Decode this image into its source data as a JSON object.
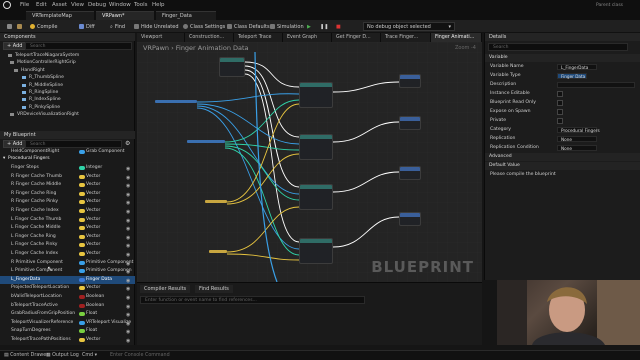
{
  "titlebar": {
    "menu": [
      "File",
      "Edit",
      "Asset",
      "View",
      "Debug",
      "Window",
      "Tools",
      "Help"
    ],
    "right_label": "Parent class"
  },
  "doc_tabs": [
    "VRTemplateMap",
    "VRPawn*",
    "Finger_Data"
  ],
  "toolbar": {
    "compile": "Compile",
    "diff": "Diff",
    "find": "Find",
    "hide_unrelated": "Hide Unrelated",
    "class_settings": "Class Settings",
    "class_defaults": "Class Defaults",
    "simulation": "Simulation",
    "debug_object": "No debug object selected"
  },
  "components": {
    "header": "Components",
    "add_label": "+ Add",
    "search_placeholder": "Search",
    "tree": [
      "TeleportTraceNiagaraSystem",
      "MotionControllerRightGrip",
      "HandRight",
      "R_ThumbSpline",
      "R_MiddleSpline",
      "R_RingSpline",
      "R_IndexSpline",
      "R_PinkySpline",
      "VRDeviceVisualizationRight"
    ]
  },
  "my_blueprint": {
    "header": "My Blueprint",
    "add_label": "+ Add",
    "search_placeholder": "Search",
    "top_row": {
      "name": "HeldComponentRight",
      "type": "Grab Component"
    },
    "category": "Procedural Fingers",
    "vars": [
      {
        "name": "Finger Steps",
        "type": "Integer",
        "color": "#2fd3a8"
      },
      {
        "name": "R Finger Cache Thumb",
        "type": "Vector",
        "color": "#e8c540"
      },
      {
        "name": "R Finger Cache Middle",
        "type": "Vector",
        "color": "#e8c540"
      },
      {
        "name": "R Finger Cache Ring",
        "type": "Vector",
        "color": "#e8c540"
      },
      {
        "name": "R Finger Cache Pinky",
        "type": "Vector",
        "color": "#e8c540"
      },
      {
        "name": "R Finger Cache Index",
        "type": "Vector",
        "color": "#e8c540"
      },
      {
        "name": "L Finger Cache Thumb",
        "type": "Vector",
        "color": "#e8c540"
      },
      {
        "name": "L Finger Cache Middle",
        "type": "Vector",
        "color": "#e8c540"
      },
      {
        "name": "L Finger Cache Ring",
        "type": "Vector",
        "color": "#e8c540"
      },
      {
        "name": "L Finger Cache Pinky",
        "type": "Vector",
        "color": "#e8c540"
      },
      {
        "name": "L Finger Cache Index",
        "type": "Vector",
        "color": "#e8c540"
      },
      {
        "name": "R Primitive Component",
        "type": "Primitive Component",
        "color": "#3aa0e8"
      },
      {
        "name": "L Primitive Component",
        "type": "Primitive Componen",
        "color": "#3aa0e8"
      },
      {
        "name": "L_FingerData",
        "type": "Finger Data",
        "color": "#3a78d8"
      },
      {
        "name": "ProjectedTeleportLocation",
        "type": "Vector",
        "color": "#e8c540"
      },
      {
        "name": "bValidTeleportLocation",
        "type": "Boolean",
        "color": "#a02020"
      },
      {
        "name": "bTeleportTraceActive",
        "type": "Boolean",
        "color": "#a02020"
      },
      {
        "name": "GrabRadiusFromGripPosition",
        "type": "Float",
        "color": "#7ad040"
      },
      {
        "name": "TeleportVisualizerReference",
        "type": "VRTeleport Visualize",
        "color": "#3aa0e8"
      },
      {
        "name": "SnapTurnDegrees",
        "type": "Float",
        "color": "#7ad040"
      },
      {
        "name": "TeleportTracePathPositions",
        "type": "Vector",
        "color": "#e8c540"
      }
    ],
    "selected_index": 13
  },
  "graph_tabs": [
    "Viewport",
    "Construction...",
    "Teleport Trace",
    "Event Graph",
    "Get Finger D...",
    "Trace Finger...",
    "Finger Animati..."
  ],
  "graph": {
    "crumb": "VRPawn › Finger Animation Data",
    "zoom": "Zoom -4",
    "watermark": "BLUEPRINT"
  },
  "compiler": {
    "tab1": "Compiler Results",
    "tab2": "Find Results",
    "search_placeholder": "Enter function or event name to find references..."
  },
  "details": {
    "header": "Details",
    "search_placeholder": "Search",
    "section": "Variable",
    "rows": [
      {
        "label": "Variable Name",
        "value": "L_FingerData",
        "kind": "text"
      },
      {
        "label": "Variable Type",
        "value": "Finger Data",
        "kind": "type"
      },
      {
        "label": "Description",
        "value": "",
        "kind": "text"
      },
      {
        "label": "Instance Editable",
        "value": "",
        "kind": "check"
      },
      {
        "label": "Blueprint Read Only",
        "value": "",
        "kind": "check"
      },
      {
        "label": "Expose on Spawn",
        "value": "",
        "kind": "check"
      },
      {
        "label": "Private",
        "value": "",
        "kind": "check"
      },
      {
        "label": "Category",
        "value": "Procedural Fingers",
        "kind": "text"
      },
      {
        "label": "Replication",
        "value": "None",
        "kind": "text"
      },
      {
        "label": "Replication Condition",
        "value": "None",
        "kind": "text"
      }
    ],
    "advanced": "Advanced",
    "default_value": "Default Value",
    "compile_msg": "Please compile the blueprint"
  },
  "statusbar": {
    "content_drawer": "Content Drawer",
    "output_log": "Output Log",
    "cmd": "Cmd",
    "console": "Enter Console Command"
  }
}
